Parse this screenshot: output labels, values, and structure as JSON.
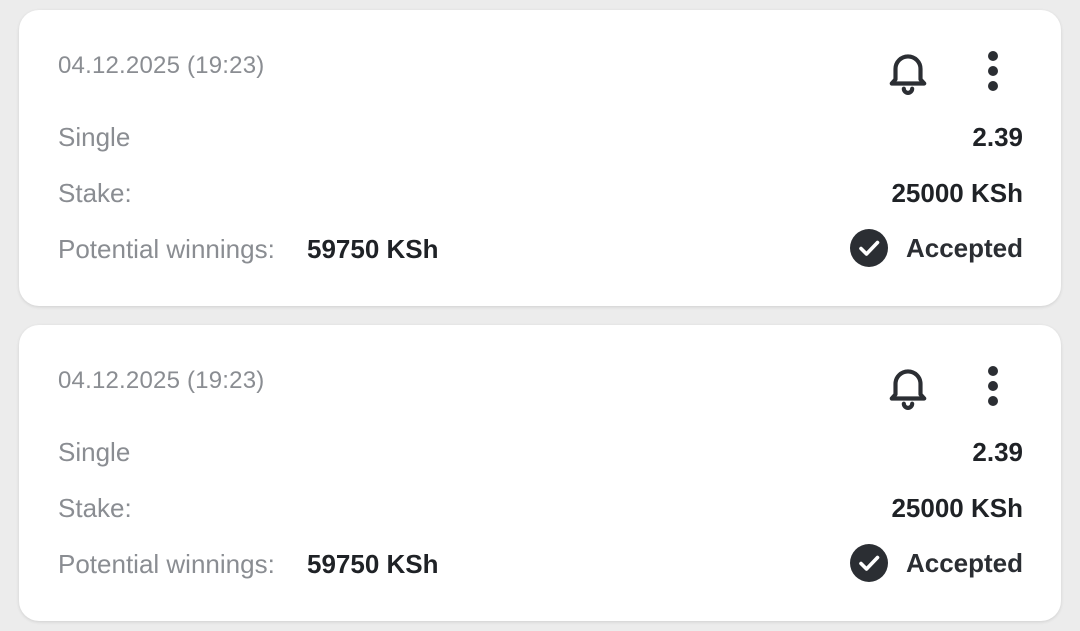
{
  "bets": [
    {
      "date": "04.12.2025 (19:23)",
      "type_label": "Single",
      "odds": "2.39",
      "stake_label": "Stake:",
      "stake_value": "25000 KSh",
      "winnings_label": "Potential winnings:",
      "winnings_value": "59750 KSh",
      "status": "Accepted",
      "icons": {
        "notify": "bell-icon",
        "menu": "more-vertical-icon",
        "status": "check-circle-icon"
      }
    },
    {
      "date": "04.12.2025 (19:23)",
      "type_label": "Single",
      "odds": "2.39",
      "stake_label": "Stake:",
      "stake_value": "25000 KSh",
      "winnings_label": "Potential winnings:",
      "winnings_value": "59750 KSh",
      "status": "Accepted",
      "icons": {
        "notify": "bell-icon",
        "menu": "more-vertical-icon",
        "status": "check-circle-icon"
      }
    }
  ],
  "colors": {
    "background": "#ececec",
    "card": "#ffffff",
    "muted_text": "#8a8d92",
    "strong_text": "#1f2226",
    "icon": "#2b2e33"
  }
}
